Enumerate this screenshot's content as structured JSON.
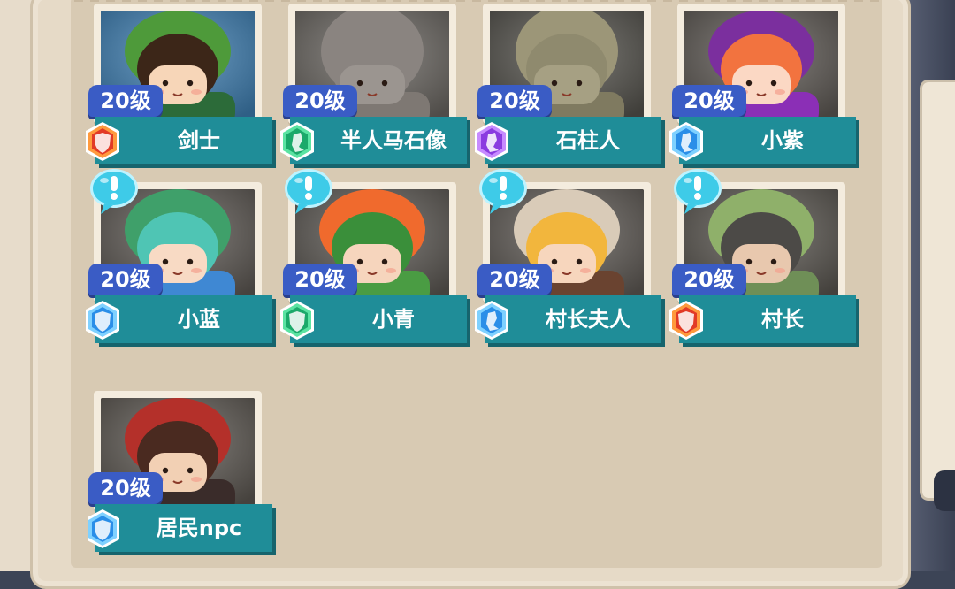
{
  "cards": [
    {
      "level": "20级",
      "name": "剑士",
      "rank_icon": "red-shield-icon",
      "rank_color": "#e23a26",
      "rank_ring": "#ff9a3d",
      "has_alert": false,
      "portrait": {
        "bg": "#3f7fb2",
        "hair": "#3c2618",
        "hat": "#4e9a3a",
        "skin": "#f7d6b8",
        "cloth": "#2c6b39"
      }
    },
    {
      "level": "20级",
      "name": "半人马石像",
      "rank_icon": "green-emblem-icon",
      "rank_color": "#1ba96a",
      "rank_ring": "#5be3a2",
      "has_alert": false,
      "portrait": {
        "bg": "#6a6661",
        "hair": "#8a8480",
        "hat": "#8a8480",
        "skin": "#9b9590",
        "cloth": "#7e7873"
      }
    },
    {
      "level": "20级",
      "name": "石柱人",
      "rank_icon": "purple-emblem-icon",
      "rank_color": "#8a3be0",
      "rank_ring": "#c78bff",
      "has_alert": false,
      "portrait": {
        "bg": "#55534d",
        "hair": "#8f8a6e",
        "hat": "#9c9678",
        "skin": "#a6a083",
        "cloth": "#7f7a60"
      }
    },
    {
      "level": "20级",
      "name": "小紫",
      "rank_icon": "blue-emblem-icon",
      "rank_color": "#2a8ee8",
      "rank_ring": "#7fd1ff",
      "has_alert": false,
      "portrait": {
        "bg": "#5f5a55",
        "hair": "#f2733f",
        "hat": "#7b2f9e",
        "skin": "#fbd8c4",
        "cloth": "#8b2fb6"
      }
    },
    {
      "level": "20级",
      "name": "小蓝",
      "rank_icon": "blue-shield-icon",
      "rank_color": "#2a8ee8",
      "rank_ring": "#7fd1ff",
      "has_alert": true,
      "portrait": {
        "bg": "#5e5954",
        "hair": "#4fc5b4",
        "hat": "#3fa06a",
        "skin": "#f8dac4",
        "cloth": "#3f88d3"
      }
    },
    {
      "level": "20级",
      "name": "小青",
      "rank_icon": "green-shield-icon",
      "rank_color": "#1ba96a",
      "rank_ring": "#5be3a2",
      "has_alert": true,
      "portrait": {
        "bg": "#5c5853",
        "hair": "#3a8f3a",
        "hat": "#f06a2d",
        "skin": "#f6d5bd",
        "cloth": "#4a9c43"
      }
    },
    {
      "level": "20级",
      "name": "村长夫人",
      "rank_icon": "blue-emblem-icon",
      "rank_color": "#2a8ee8",
      "rank_ring": "#7fd1ff",
      "has_alert": true,
      "portrait": {
        "bg": "#5f5a55",
        "hair": "#f2b63d",
        "hat": "#d9cbb8",
        "skin": "#f7d6bd",
        "cloth": "#6a4330"
      }
    },
    {
      "level": "20级",
      "name": "村长",
      "rank_icon": "red-shield-icon",
      "rank_color": "#e23a26",
      "rank_ring": "#ff9a3d",
      "has_alert": true,
      "portrait": {
        "bg": "#5a5650",
        "hair": "#4c4a47",
        "hat": "#8fb06a",
        "skin": "#e8c8ae",
        "cloth": "#6f8f57"
      }
    },
    {
      "level": "20级",
      "name": "居民npc",
      "rank_icon": "blue-shield-icon",
      "rank_color": "#2a8ee8",
      "rank_ring": "#7fd1ff",
      "has_alert": false,
      "portrait": {
        "bg": "#5d5852",
        "hair": "#4a2a20",
        "hat": "#b4302a",
        "skin": "#f2d0b4",
        "cloth": "#3a2c2a"
      }
    }
  ]
}
